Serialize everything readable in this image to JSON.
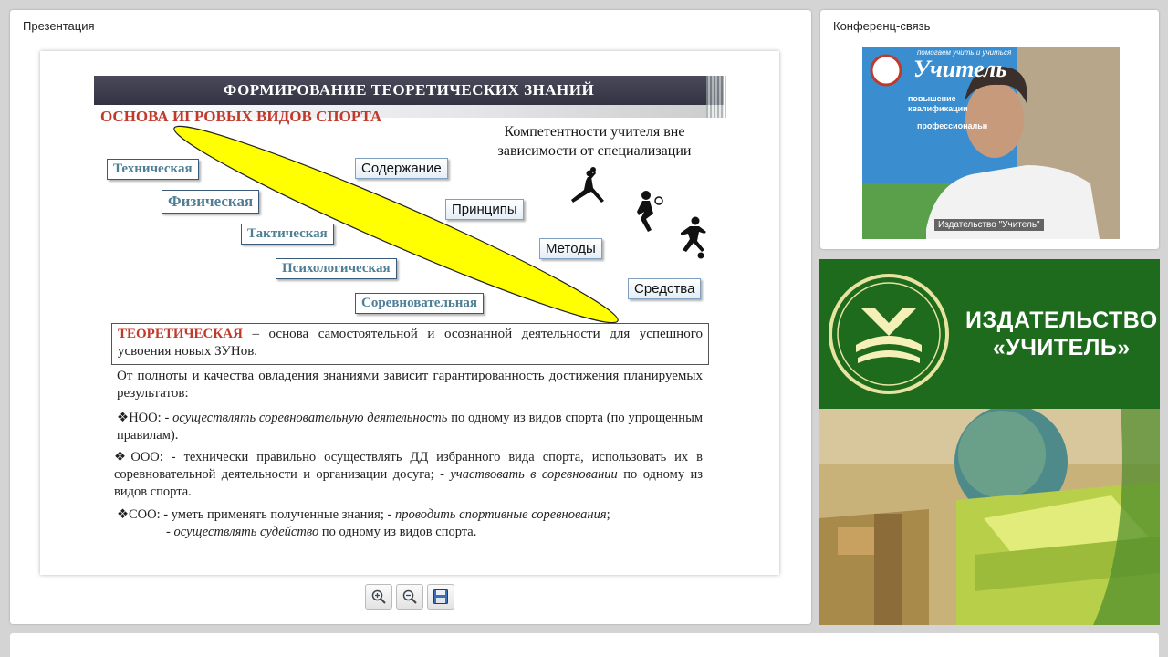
{
  "presentation": {
    "title": "Презентация",
    "slide": {
      "header": "ФОРМИРОВАНИЕ ТЕОРЕТИЧЕСКИХ ЗНАНИЙ",
      "subtitle": "ОСНОВА ИГРОВЫХ ВИДОВ СПОРТА",
      "competence_title": "Компетентности учителя вне зависимости от специализации",
      "training_types": [
        "Техническая",
        "Физическая",
        "Тактическая",
        "Психологическая",
        "Соревновательная"
      ],
      "competences": [
        "Содержание",
        "Принципы",
        "Методы",
        "Средства"
      ],
      "theory_keyword": "ТЕОРЕТИЧЕСКАЯ",
      "theory_text": " – основа самостоятельной и осознанной деятельности для успешного усвоения новых ЗУНов.",
      "intro": "От полноты и качества овладения знаниями зависит гарантированность достижения планируемых результатов:",
      "noo_label": "❖НОО: - ",
      "noo_italic": "осуществлять соревновательную деятельность",
      "noo_rest": " по одному из видов спорта (по упрощенным правилам).",
      "ooo_label": "❖ООО: - технически правильно осуществлять ДД избранного вида спорта, использовать их в соревновательной деятельности и организации досуга; - ",
      "ooo_italic": "участвовать в соревновании",
      "ooo_rest": " по одному из видов спорта.",
      "soo_label": "❖СОО: - уметь применять полученные знания; - ",
      "soo_italic": "проводить спортивные соревнования",
      "soo_rest": ";",
      "soo2_prefix": "- ",
      "soo2_italic": "осуществлять судейство",
      "soo2_rest": " по одному из видов спорта."
    },
    "toolbar": {
      "zoom_in_icon": "zoom-in-icon",
      "zoom_out_icon": "zoom-out-icon",
      "save_icon": "save-icon"
    }
  },
  "conference": {
    "title": "Конференц-связь",
    "video_caption": "Издательство \"Учитель\"",
    "banner_text": "Учитель",
    "banner_tagline": "помогаем учить и учиться",
    "banner_items": [
      "повышение квалификации",
      "профессиональн"
    ]
  },
  "publisher": {
    "name_line1": "ИЗДАТЕЛЬСТВО",
    "name_line2": "«УЧИТЕЛЬ»"
  },
  "colors": {
    "accent_red": "#c0392b",
    "label_teal": "#4e7f96",
    "ellipse_yellow": "#ffff00",
    "publisher_green": "#1e6b1e"
  }
}
